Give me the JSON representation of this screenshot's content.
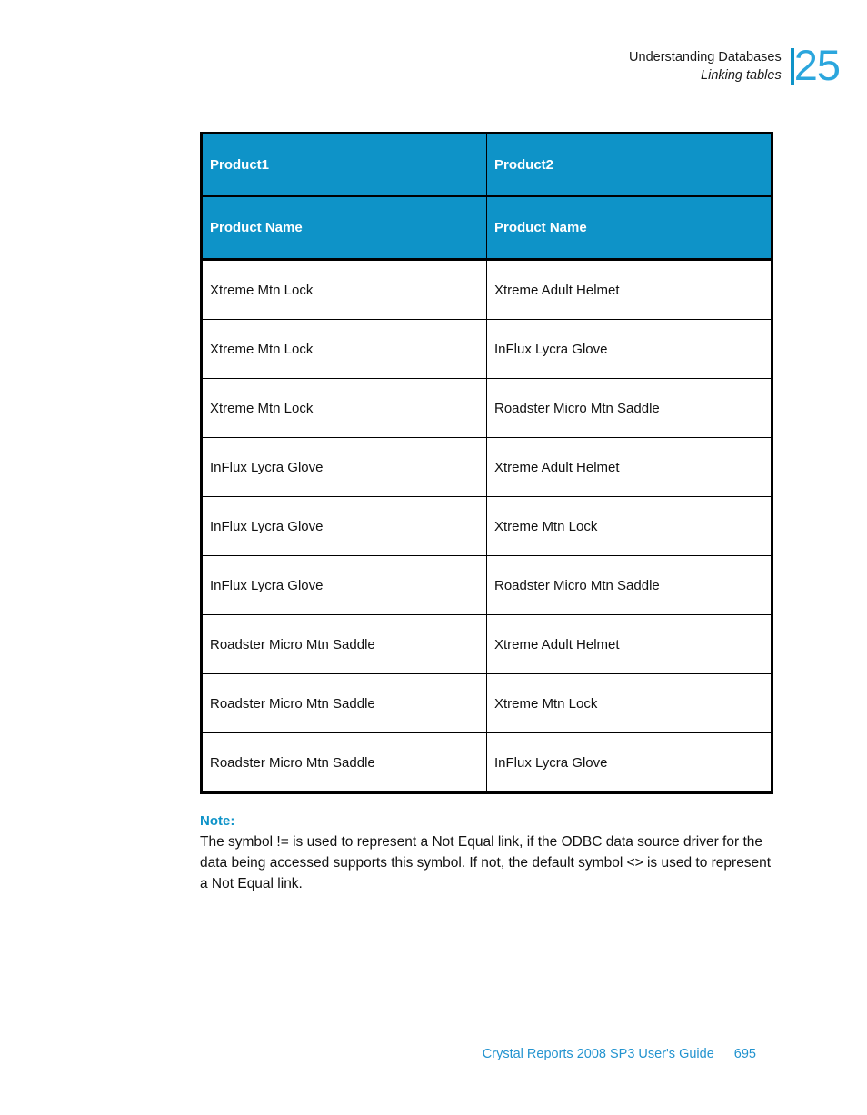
{
  "header": {
    "line1": "Understanding Databases",
    "line2": "Linking tables",
    "chapter_number": "25",
    "accent_color": "#0e93c8"
  },
  "table": {
    "group_headers": [
      "Product1",
      "Product2"
    ],
    "column_headers": [
      "Product Name",
      "Product Name"
    ],
    "header_bg": "#0e93c8",
    "header_text_color": "#ffffff",
    "rows": [
      [
        "Xtreme Mtn Lock",
        "Xtreme Adult Helmet"
      ],
      [
        "Xtreme Mtn Lock",
        "InFlux Lycra Glove"
      ],
      [
        "Xtreme Mtn Lock",
        "Roadster Micro Mtn Saddle"
      ],
      [
        "InFlux Lycra Glove",
        "Xtreme Adult Helmet"
      ],
      [
        "InFlux Lycra Glove",
        "Xtreme Mtn Lock"
      ],
      [
        "InFlux Lycra Glove",
        "Roadster Micro Mtn Saddle"
      ],
      [
        "Roadster Micro Mtn Saddle",
        "Xtreme Adult Helmet"
      ],
      [
        "Roadster Micro Mtn Saddle",
        "Xtreme Mtn Lock"
      ],
      [
        "Roadster Micro Mtn Saddle",
        "InFlux Lycra Glove"
      ]
    ]
  },
  "note": {
    "label": "Note:",
    "body": "The symbol != is used to represent a Not Equal link, if the ODBC data source driver for the data being accessed supports this symbol. If not, the default symbol <> is used to represent a Not Equal link.",
    "label_color": "#0e93c8"
  },
  "footer": {
    "title": "Crystal Reports 2008 SP3 User's Guide",
    "page_number": "695",
    "color": "#2293cf"
  }
}
